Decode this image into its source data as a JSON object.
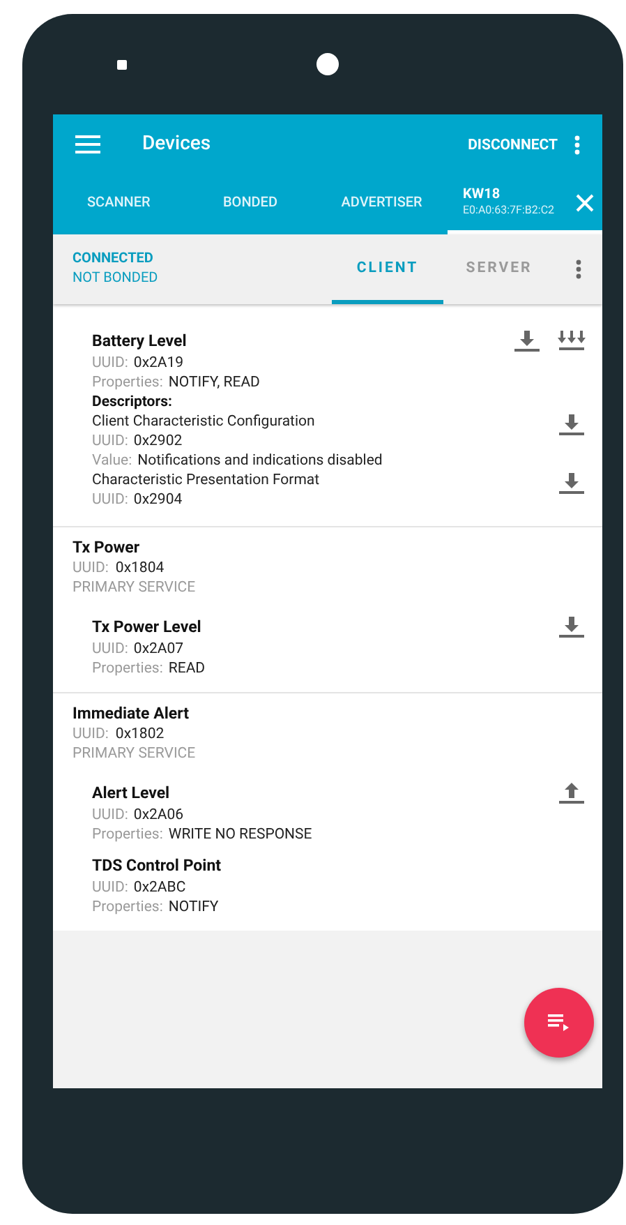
{
  "app_bar": {
    "title": "Devices",
    "action": "DISCONNECT"
  },
  "tabs": [
    {
      "label": "SCANNER",
      "selected": false
    },
    {
      "label": "BONDED",
      "selected": false
    },
    {
      "label": "ADVERTISER",
      "selected": false
    },
    {
      "label": "KW18",
      "subtitle": "E0:A0:63:7F:B2:C2",
      "selected": true,
      "closable": true
    }
  ],
  "connection": {
    "state": "CONNECTED",
    "bond": "NOT BONDED"
  },
  "subtabs": [
    {
      "label": "CLIENT",
      "selected": true
    },
    {
      "label": "SERVER",
      "selected": false
    }
  ],
  "services": [
    {
      "characteristics": [
        {
          "name": "Battery Level",
          "lines": [
            {
              "label": "UUID:",
              "value": "0x2A19"
            },
            {
              "label": "Properties:",
              "value": "NOTIFY, READ"
            }
          ],
          "actions": [
            {
              "kind": "read"
            },
            {
              "kind": "notify"
            }
          ],
          "descriptors_heading": "Descriptors:",
          "descriptors": [
            {
              "name": "Client Characteristic Configuration",
              "lines": [
                {
                  "label": "UUID:",
                  "value": "0x2902"
                },
                {
                  "label": "Value:",
                  "value": "Notifications and indications disabled"
                }
              ],
              "actions": [
                {
                  "kind": "read"
                }
              ]
            },
            {
              "name": "Characteristic Presentation Format",
              "lines": [
                {
                  "label": "UUID:",
                  "value": "0x2904"
                }
              ],
              "actions": [
                {
                  "kind": "read"
                }
              ]
            }
          ]
        }
      ]
    },
    {
      "name": "Tx Power",
      "uuid_label": "UUID:",
      "uuid": "0x1804",
      "type": "PRIMARY SERVICE",
      "characteristics": [
        {
          "name": "Tx Power Level",
          "lines": [
            {
              "label": "UUID:",
              "value": "0x2A07"
            },
            {
              "label": "Properties:",
              "value": "READ"
            }
          ],
          "actions": [
            {
              "kind": "read"
            }
          ]
        }
      ]
    },
    {
      "name": "Immediate Alert",
      "uuid_label": "UUID:",
      "uuid": "0x1802",
      "type": "PRIMARY SERVICE",
      "characteristics": [
        {
          "name": "Alert Level",
          "lines": [
            {
              "label": "UUID:",
              "value": "0x2A06"
            },
            {
              "label": "Properties:",
              "value": "WRITE NO RESPONSE"
            }
          ],
          "actions": [
            {
              "kind": "write"
            }
          ]
        },
        {
          "name": "TDS Control Point",
          "lines": [
            {
              "label": "UUID:",
              "value": "0x2ABC"
            },
            {
              "label": "Properties:",
              "value": "NOTIFY"
            }
          ]
        }
      ]
    }
  ]
}
